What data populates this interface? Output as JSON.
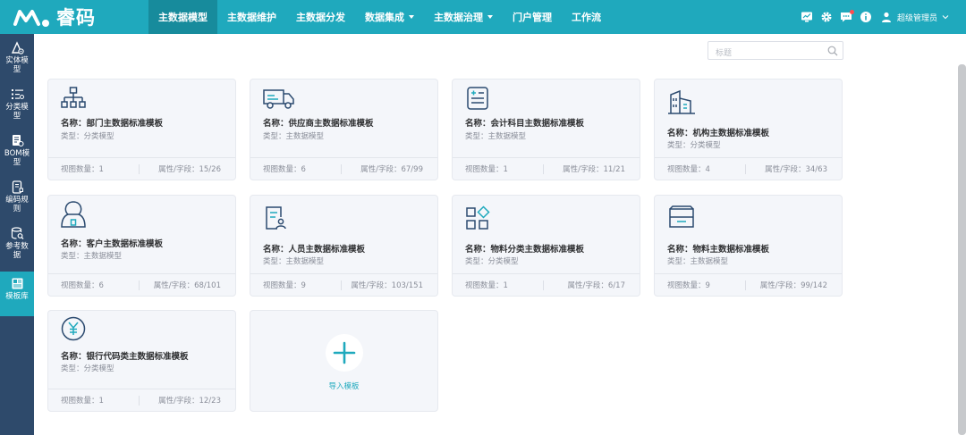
{
  "app": {
    "brand": "睿码"
  },
  "nav": [
    {
      "label": "主数据模型",
      "active": true,
      "dropdown": false
    },
    {
      "label": "主数据维护",
      "active": false,
      "dropdown": false
    },
    {
      "label": "主数据分发",
      "active": false,
      "dropdown": false
    },
    {
      "label": "数据集成",
      "active": false,
      "dropdown": true
    },
    {
      "label": "主数据治理",
      "active": false,
      "dropdown": true
    },
    {
      "label": "门户管理",
      "active": false,
      "dropdown": false
    },
    {
      "label": "工作流",
      "active": false,
      "dropdown": false
    }
  ],
  "tools": {
    "icons": [
      "monitor-icon",
      "gear-icon",
      "message-icon",
      "info-icon"
    ],
    "user": "超级管理员"
  },
  "sidebar": [
    {
      "label": "实体模型",
      "icon": "entity-icon",
      "active": false
    },
    {
      "label": "分类模型",
      "icon": "category-icon",
      "active": false
    },
    {
      "label": "BOM模型",
      "icon": "bom-icon",
      "active": false
    },
    {
      "label": "编码规则",
      "icon": "code-rule-icon",
      "active": false
    },
    {
      "label": "参考数据",
      "icon": "reference-data-icon",
      "active": false
    },
    {
      "label": "模板库",
      "icon": "template-library-icon",
      "active": true
    }
  ],
  "search": {
    "placeholder": "标题"
  },
  "cards": [
    {
      "name": "名称：部门主数据标准模板",
      "type": "类型：分类模型",
      "views": "视图数量：1",
      "fields": "属性/字段：15/26",
      "icon": "org-chart-icon"
    },
    {
      "name": "名称：供应商主数据标准模板",
      "type": "类型：主数据模型",
      "views": "视图数量：6",
      "fields": "属性/字段：67/99",
      "icon": "truck-icon"
    },
    {
      "name": "名称：会计科目主数据标准模板",
      "type": "类型：主数据模型",
      "views": "视图数量：1",
      "fields": "属性/字段：11/21",
      "icon": "ledger-icon"
    },
    {
      "name": "名称：机构主数据标准模板",
      "type": "类型：分类模型",
      "views": "视图数量：4",
      "fields": "属性/字段：34/63",
      "icon": "building-icon"
    },
    {
      "name": "名称：客户主数据标准模板",
      "type": "类型：主数据模型",
      "views": "视图数量：6",
      "fields": "属性/字段：68/101",
      "icon": "customer-icon"
    },
    {
      "name": "名称：人员主数据标准模板",
      "type": "类型：主数据模型",
      "views": "视图数量：9",
      "fields": "属性/字段：103/151",
      "icon": "person-doc-icon"
    },
    {
      "name": "名称：物料分类主数据标准模板",
      "type": "类型：分类模型",
      "views": "视图数量：1",
      "fields": "属性/字段：6/17",
      "icon": "material-category-icon"
    },
    {
      "name": "名称：物料主数据标准模板",
      "type": "类型：主数据模型",
      "views": "视图数量：9",
      "fields": "属性/字段：99/142",
      "icon": "inbox-icon"
    },
    {
      "name": "名称：银行代码类主数据标准模板",
      "type": "类型：分类模型",
      "views": "视图数量：1",
      "fields": "属性/字段：12/23",
      "icon": "yen-icon"
    }
  ],
  "import_card": {
    "label": "导入模板",
    "icon": "plus-icon"
  },
  "colors": {
    "primary": "#1fa9bd",
    "nav_active": "#178b9c",
    "sidebar": "#2e4a6b",
    "card_bg": "#f4f6fa",
    "icon_stroke": "#2b4a6f"
  }
}
